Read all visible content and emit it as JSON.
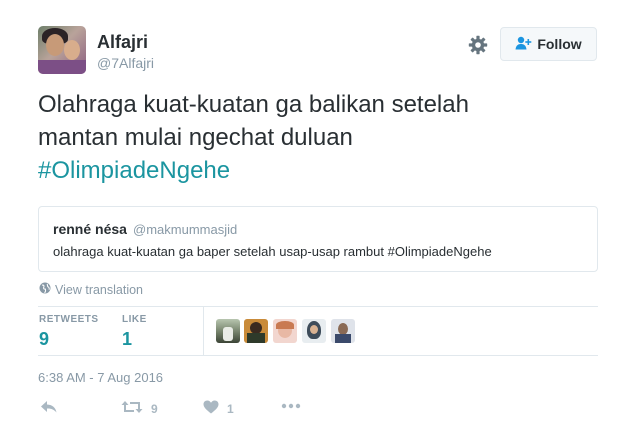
{
  "author": {
    "name": "Alfajri",
    "handle": "@7Alfajri"
  },
  "follow_label": "Follow",
  "tweet": {
    "line1": "Olahraga kuat-kuatan ga balikan setelah",
    "line2": "mantan mulai ngechat duluan",
    "hashtag": "#OlimpiadeNgehe"
  },
  "quoted": {
    "name": "renné nésa",
    "handle": "@makmummasjid",
    "text": "olahraga kuat-kuatan ga baper setelah usap-usap rambut #OlimpiadeNgehe"
  },
  "view_translation": "View translation",
  "stats": {
    "retweets_label": "RETWEETS",
    "retweets_value": "9",
    "likes_label": "LIKE",
    "likes_value": "1"
  },
  "timestamp": "6:38 AM - 7 Aug 2016",
  "actions": {
    "retweet_count": "9",
    "like_count": "1"
  },
  "colors": {
    "accent": "#1b95a0",
    "muted": "#8899a6",
    "text": "#292f33",
    "border": "#e1e8ed"
  },
  "icons": [
    "gear-icon",
    "follow-person-plus-icon",
    "globe-icon",
    "reply-icon",
    "retweet-icon",
    "heart-icon",
    "more-icon"
  ]
}
